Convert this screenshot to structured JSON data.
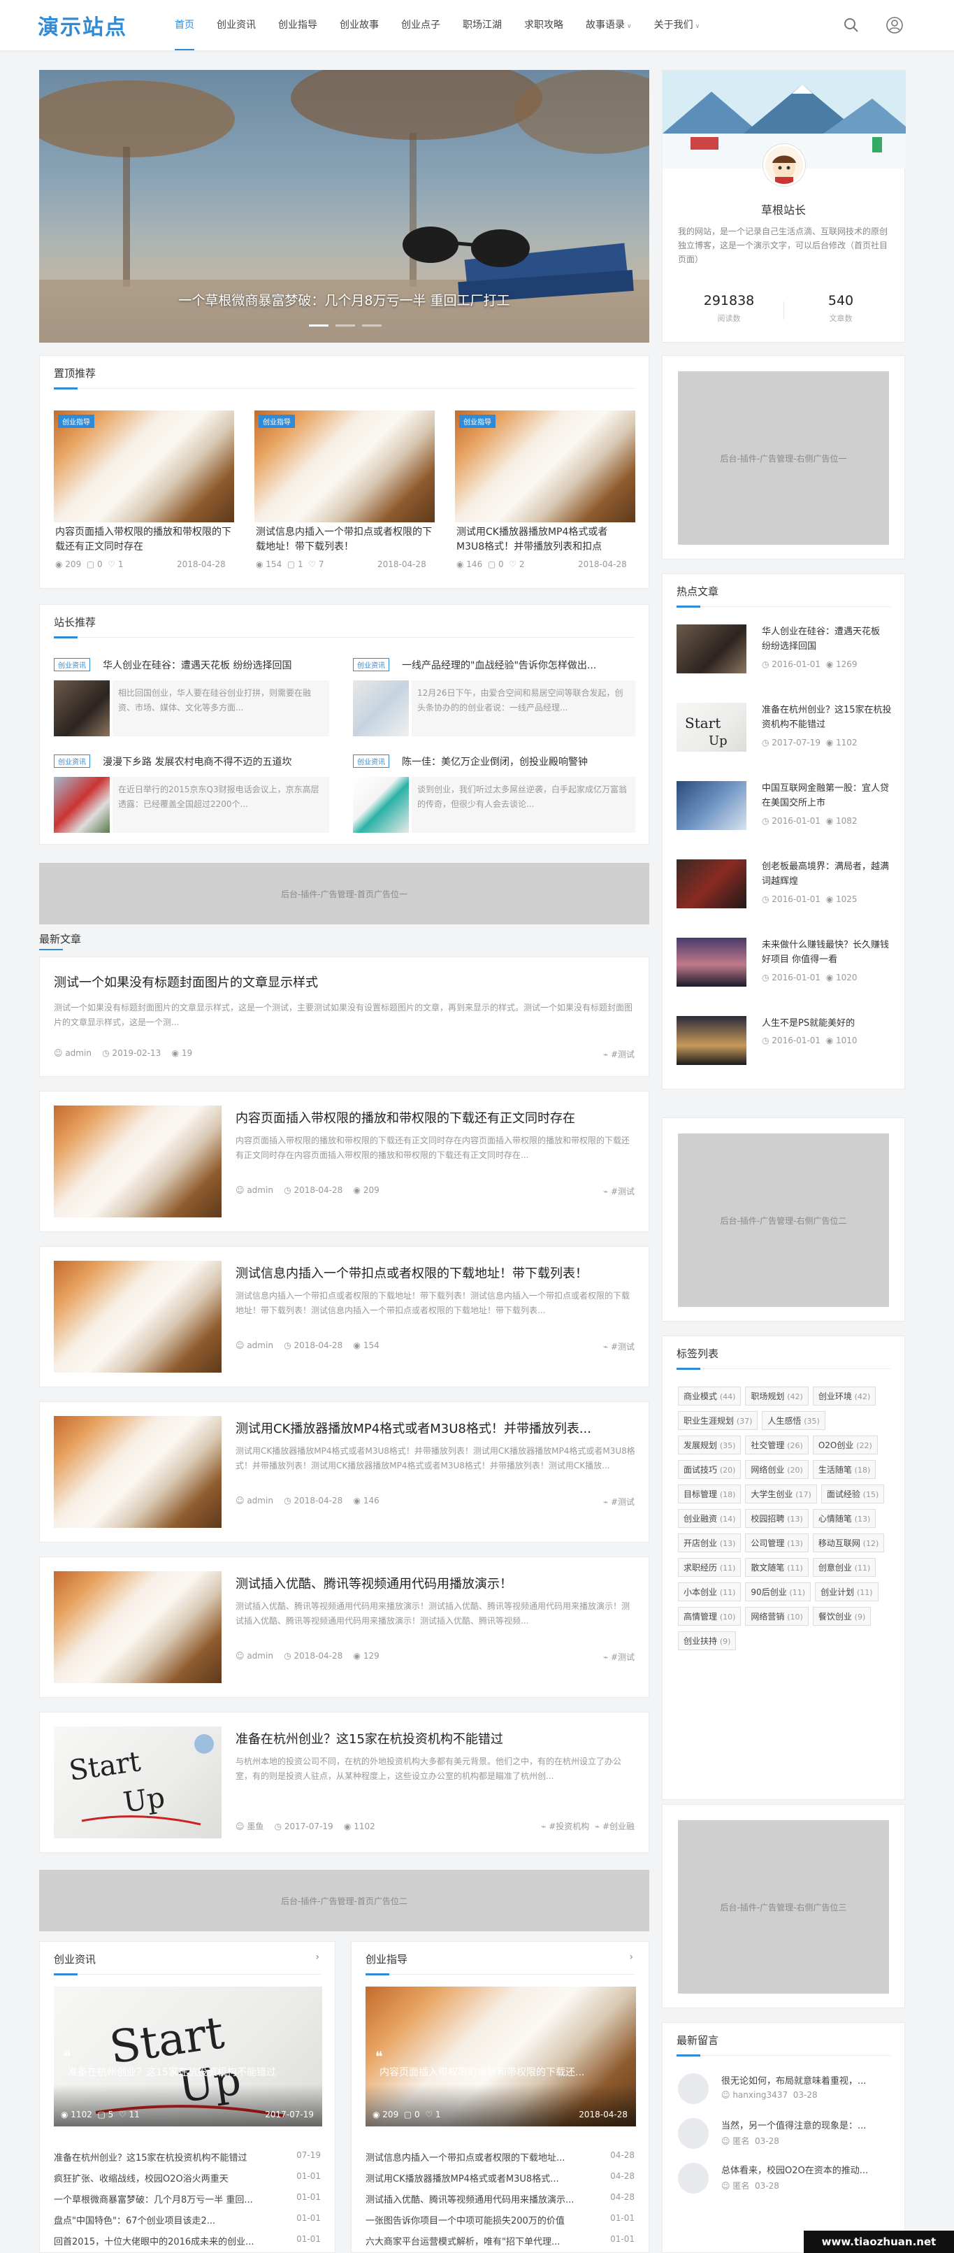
{
  "header": {
    "logo": "演示站点",
    "nav": [
      "首页",
      "创业资讯",
      "创业指导",
      "创业故事",
      "创业点子",
      "职场江湖",
      "求职攻略",
      "故事语录",
      "关于我们"
    ]
  },
  "slider": {
    "caption": "一个草根微商暴富梦破：几个月8万亏一半 重回工厂打工"
  },
  "profile": {
    "name": "草根站长",
    "desc": "我的网站，是一个记录自己生活点滴、互联网技术的原创独立博客，这是一个演示文字，可以后台修改（首页社目页面）",
    "views": "291838",
    "views_label": "阅读数",
    "articles": "540",
    "articles_label": "文章数"
  },
  "top_rec": {
    "title": "置顶推荐",
    "items": [
      {
        "tag": "创业指导",
        "title": "内容页面插入带权限的播放和带权限的下载还有正文同时存在",
        "views": "209",
        "comments": "0",
        "likes": "1",
        "date": "2018-04-28"
      },
      {
        "tag": "创业指导",
        "title": "测试信息内插入一个带扣点或者权限的下载地址！带下载列表！",
        "views": "154",
        "comments": "1",
        "likes": "7",
        "date": "2018-04-28"
      },
      {
        "tag": "创业指导",
        "title": "测试用CK播放器播放MP4格式或者M3U8格式！并带播放列表和扣点",
        "views": "146",
        "comments": "0",
        "likes": "2",
        "date": "2018-04-28"
      }
    ]
  },
  "site_rec": {
    "title": "站长推荐",
    "items": [
      {
        "tag": "创业资讯",
        "title": "华人创业在硅谷：遭遇天花板 纷纷选择回国",
        "excerpt": "相比回国创业，华人要在硅谷创业打拼，则需要在融资、市场、媒体、文化等多方面..."
      },
      {
        "tag": "创业资讯",
        "title": "一线产品经理的\"血战经验\"告诉你怎样做出...",
        "excerpt": "12月26日下午，由爱合空间和易居空间等联合发起，创头条协办的的创业者说：一线产品经理..."
      },
      {
        "tag": "创业资讯",
        "title": "漫漫下乡路 发展农村电商不得不迈的五道坎",
        "excerpt": "在近日举行的2015京东Q3财报电话会议上，京东高层透露：已经覆盖全国超过2200个..."
      },
      {
        "tag": "创业资讯",
        "title": "陈一佳：美亿万企业倒闭，创投业殿响警钟",
        "excerpt": "谈到创业，我们听过太多屌丝逆袭，白手起家成亿万富翁的传奇，但很少有人会去谈论..."
      }
    ]
  },
  "ads": {
    "home1": "后台-插件-广告管理-首页广告位一",
    "home2": "后台-插件-广告管理-首页广告位二",
    "right1": "后台-插件-广告管理-右侧广告位一",
    "right2": "后台-插件-广告管理-右侧广告位二",
    "right3": "后台-插件-广告管理-右侧广告位三"
  },
  "latest": {
    "title": "最新文章",
    "text_post": {
      "title": "测试一个如果没有标题封面图片的文章显示样式",
      "excerpt": "测试一个如果没有标题封面图片的文章显示样式，这是一个测试，主要测试如果没有设置标题图片的文章，再到来显示的样式。测试一个如果没有标题封面图片的文章显示样式，这是一个测...",
      "author": "admin",
      "date": "2019-02-13",
      "views": "19",
      "tag": "#测试"
    },
    "posts": [
      {
        "title": "内容页面插入带权限的播放和带权限的下载还有正文同时存在",
        "excerpt": "内容页面插入带权限的播放和带权限的下载还有正文同时存在内容页面插入带权限的播放和带权限的下载还有正文同时存在内容页面插入带权限的播放和带权限的下载还有正文同时存在...",
        "author": "admin",
        "date": "2018-04-28",
        "views": "209",
        "tag": "#测试",
        "img": "cat"
      },
      {
        "title": "测试信息内插入一个带扣点或者权限的下载地址！带下载列表！",
        "excerpt": "测试信息内插入一个带扣点或者权限的下载地址！带下载列表！测试信息内插入一个带扣点或者权限的下载地址！带下载列表！测试信息内插入一个带扣点或者权限的下载地址！带下载列表...",
        "author": "admin",
        "date": "2018-04-28",
        "views": "154",
        "tag": "#测试",
        "img": "cat"
      },
      {
        "title": "测试用CK播放器播放MP4格式或者M3U8格式！并带播放列表...",
        "excerpt": "测试用CK播放器播放MP4格式或者M3U8格式！并带播放列表！测试用CK播放器播放MP4格式或者M3U8格式！并带播放列表！测试用CK播放器播放MP4格式或者M3U8格式！并带播放列表！测试用CK播放...",
        "author": "admin",
        "date": "2018-04-28",
        "views": "146",
        "tag": "#测试",
        "img": "cat"
      },
      {
        "title": "测试插入优酷、腾讯等视频通用代码用播放演示！",
        "excerpt": "测试插入优酷、腾讯等视频通用代码用来播放演示！测试插入优酷、腾讯等视频通用代码用来播放演示！测试插入优酷、腾讯等视频通用代码用来播放演示！测试插入优酷、腾讯等视频...",
        "author": "admin",
        "date": "2018-04-28",
        "views": "129",
        "tag": "#测试",
        "img": "cat"
      },
      {
        "title": "准备在杭州创业？这15家在杭投资机构不能错过",
        "excerpt": "与杭州本地的投资公司不同，在杭的外地投资机构大多都有美元背景。他们之中，有的在杭州设立了办公室，有的则是投资人驻点，从某种程度上，这些设立办公室的机构都是瞄准了杭州创...",
        "author": "墨鱼",
        "date": "2017-07-19",
        "views": "1102",
        "tag": "#投资机构",
        "tag2": "#创业融",
        "img": "startup"
      }
    ]
  },
  "bottom_cols": [
    {
      "title": "创业资讯",
      "feature": {
        "title": "准备在杭州创业？这15家在杭投资机构不能错过",
        "views": "1102",
        "comments": "5",
        "likes": "11",
        "date": "2017-07-19"
      },
      "list": [
        {
          "t": "准备在杭州创业？这15家在杭投资机构不能错过",
          "d": "07-19"
        },
        {
          "t": "疯狂扩张、收缩战线，校园O2O浴火两重天",
          "d": "01-01"
        },
        {
          "t": "一个草根微商暴富梦破：几个月8万亏一半 重回...",
          "d": "01-01"
        },
        {
          "t": "盘点\"中国特色\"：67个创业项目该走2...",
          "d": "01-01"
        },
        {
          "t": "回首2015，十位大佬眼中的2016成未来的创业...",
          "d": "01-01"
        }
      ]
    },
    {
      "title": "创业指导",
      "feature": {
        "title": "内容页面插入带权限的播放和带权限的下载还...",
        "views": "209",
        "comments": "0",
        "likes": "1",
        "date": "2018-04-28"
      },
      "list": [
        {
          "t": "测试信息内插入一个带扣点或者权限的下载地址...",
          "d": "04-28"
        },
        {
          "t": "测试用CK播放器播放MP4格式或者M3U8格式...",
          "d": "04-28"
        },
        {
          "t": "测试插入优酷、腾讯等视频通用代码用来播放演示...",
          "d": "04-28"
        },
        {
          "t": "一张图告诉你项目一个中项可能损失200万的价值",
          "d": "01-01"
        },
        {
          "t": "六大商家平台运营模式解析，唯有\"招下单代理...",
          "d": "01-01"
        }
      ]
    }
  ],
  "hot": {
    "title": "热点文章",
    "items": [
      {
        "title": "华人创业在硅谷：遭遇天花板 纷纷选择回国",
        "date": "2016-01-01",
        "views": "1269"
      },
      {
        "title": "准备在杭州创业？这15家在杭投资机构不能错过",
        "date": "2017-07-19",
        "views": "1102"
      },
      {
        "title": "中国互联网金融第一股：宜人贷在美国交所上市",
        "date": "2016-01-01",
        "views": "1082"
      },
      {
        "title": "创老板最高境界：满局者，越满词越辉煌",
        "date": "2016-01-01",
        "views": "1025"
      },
      {
        "title": "未来做什么赚钱最快？长久赚钱好项目 你值得一看",
        "date": "2016-01-01",
        "views": "1020"
      },
      {
        "title": "人生不是PS就能美好的",
        "date": "2016-01-01",
        "views": "1010"
      }
    ]
  },
  "tags": {
    "title": "标签列表",
    "items": [
      {
        "n": "商业模式",
        "c": "(44)"
      },
      {
        "n": "职场规划",
        "c": "(42)"
      },
      {
        "n": "创业环境",
        "c": "(42)"
      },
      {
        "n": "职业生涯规划",
        "c": "(37)"
      },
      {
        "n": "人生感悟",
        "c": "(35)"
      },
      {
        "n": "发展规划",
        "c": "(35)"
      },
      {
        "n": "社交管理",
        "c": "(26)"
      },
      {
        "n": "O2O创业",
        "c": "(22)"
      },
      {
        "n": "面试技巧",
        "c": "(20)"
      },
      {
        "n": "网络创业",
        "c": "(20)"
      },
      {
        "n": "生活随笔",
        "c": "(18)"
      },
      {
        "n": "目标管理",
        "c": "(18)"
      },
      {
        "n": "大学生创业",
        "c": "(17)"
      },
      {
        "n": "面试经验",
        "c": "(15)"
      },
      {
        "n": "创业融资",
        "c": "(14)"
      },
      {
        "n": "校园招聘",
        "c": "(13)"
      },
      {
        "n": "心情随笔",
        "c": "(13)"
      },
      {
        "n": "开店创业",
        "c": "(13)"
      },
      {
        "n": "公司管理",
        "c": "(13)"
      },
      {
        "n": "移动互联网",
        "c": "(12)"
      },
      {
        "n": "求职经历",
        "c": "(11)"
      },
      {
        "n": "散文随笔",
        "c": "(11)"
      },
      {
        "n": "创意创业",
        "c": "(11)"
      },
      {
        "n": "小本创业",
        "c": "(11)"
      },
      {
        "n": "90后创业",
        "c": "(11)"
      },
      {
        "n": "创业计划",
        "c": "(11)"
      },
      {
        "n": "高情管理",
        "c": "(10)"
      },
      {
        "n": "网络营销",
        "c": "(10)"
      },
      {
        "n": "餐饮创业",
        "c": "(9)"
      },
      {
        "n": "创业扶持",
        "c": "(9)"
      }
    ]
  },
  "comments": {
    "title": "最新留言",
    "items": [
      {
        "text": "很无论如何，布局就意味着重视，...",
        "user": "hanxing3437",
        "date": "03-28"
      },
      {
        "text": "当然，另一个值得注意的现象是：...",
        "user": "匿名",
        "date": "03-28"
      },
      {
        "text": "总体看来，校园O2O在资本的推动...",
        "user": "匿名",
        "date": "03-28"
      }
    ]
  },
  "watermark": "www.tiaozhuan.net",
  "colors": {
    "accent": "#2f8bd8",
    "bg": "#f3f4f5"
  }
}
